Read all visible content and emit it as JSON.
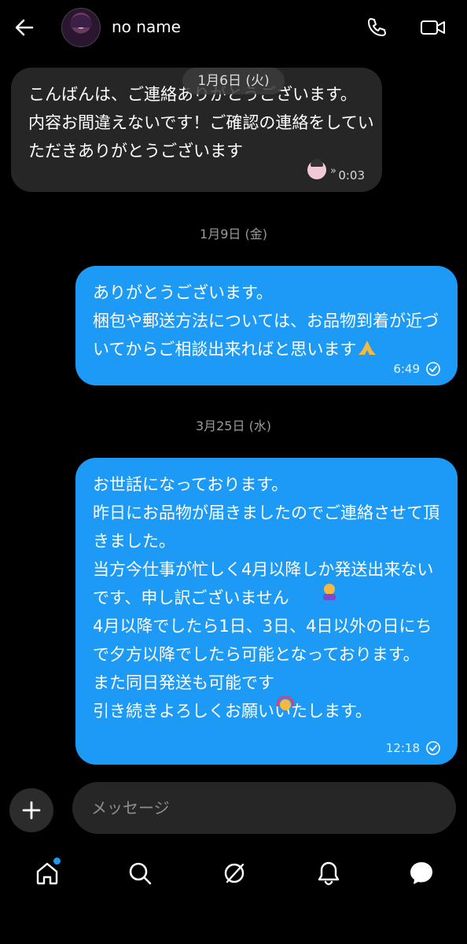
{
  "header": {
    "contact_name": "no name"
  },
  "messages": [
    {
      "direction": "in",
      "text": "こんばんは、ご連絡ありがとうございます。\n内容お間違えないです！ご確認の連絡をしていただきありがとうございます",
      "time": "0:03"
    },
    {
      "direction": "out",
      "text": "ありがとうございます。\n梱包や郵送方法については、お品物到着が近づいてからご相談出来ればと思います",
      "time": "6:49"
    },
    {
      "direction": "out",
      "text": "お世話になっております。\n昨日にお品物が届きましたのでご連絡させて頂きました。\n当方今仕事が忙しく4月以降しか発送出来ないです、申し訳ございません\n4月以降でしたら1日、3日、4日以外の日にちで夕方以降でしたら可能となっております。\nまた同日発送も可能です\n引き続きよろしくお願いいたします。",
      "time": "12:18"
    }
  ],
  "dates": {
    "d1": "1月6日 (火)",
    "d2": "1月9日 (金)",
    "d3": "3月25日 (水)"
  },
  "composer": {
    "placeholder": "メッセージ"
  },
  "nav": [
    "home-icon",
    "search-icon",
    "explore-icon",
    "notifications-icon",
    "messages-icon"
  ],
  "colors": {
    "outgoing": "#1c9af5",
    "incoming": "#262626",
    "background": "#000000"
  }
}
